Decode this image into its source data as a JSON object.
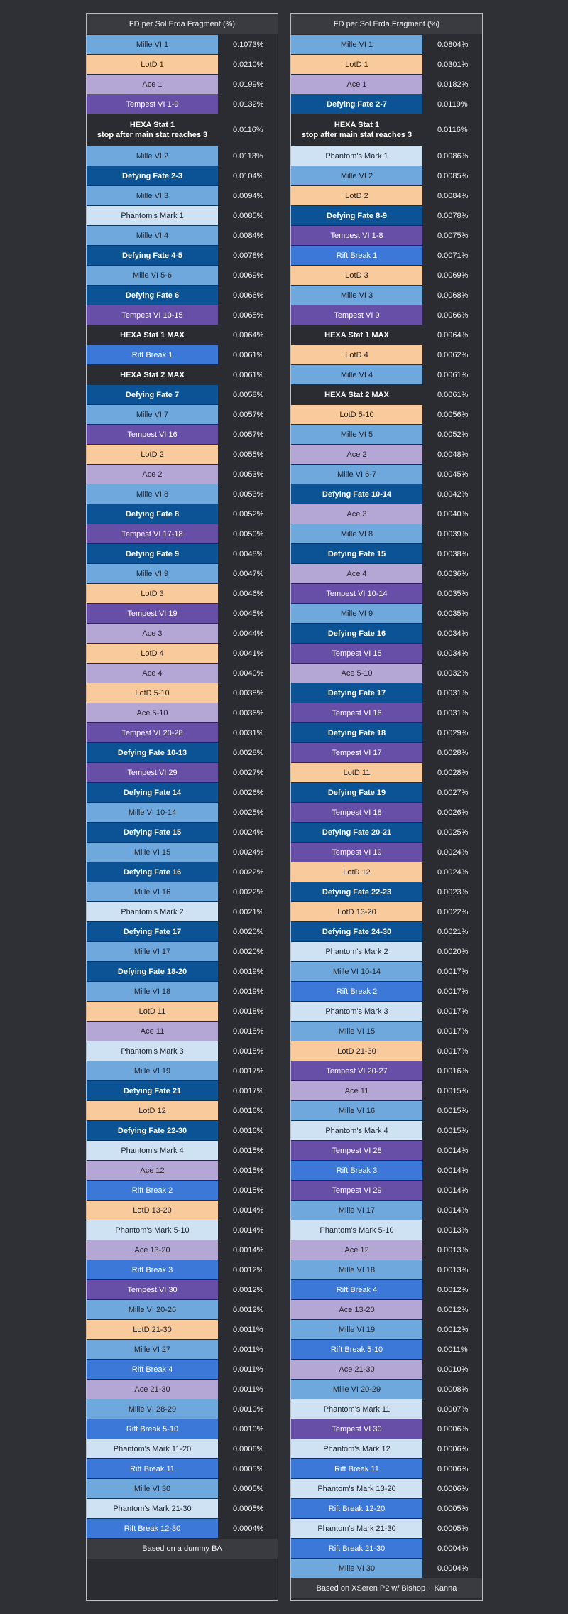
{
  "tables": [
    {
      "header": "FD per Sol Erda Fragment (%)",
      "footer": "Based on a dummy BA",
      "rows": [
        {
          "name": "Mille VI 1",
          "value": "0.1073%",
          "cat": "mille"
        },
        {
          "name": "LotD 1",
          "value": "0.0210%",
          "cat": "lotd"
        },
        {
          "name": "Ace 1",
          "value": "0.0199%",
          "cat": "ace"
        },
        {
          "name": "Tempest VI 1-9",
          "value": "0.0132%",
          "cat": "tempest"
        },
        {
          "name": "HEXA Stat 1\nstop after main stat reaches 3",
          "value": "0.0116%",
          "cat": "hexa",
          "tall": true
        },
        {
          "name": "Mille VI 2",
          "value": "0.0113%",
          "cat": "mille"
        },
        {
          "name": "Defying Fate 2-3",
          "value": "0.0104%",
          "cat": "defying"
        },
        {
          "name": "Mille VI 3",
          "value": "0.0094%",
          "cat": "mille"
        },
        {
          "name": "Phantom's Mark 1",
          "value": "0.0085%",
          "cat": "phantom"
        },
        {
          "name": "Mille VI 4",
          "value": "0.0084%",
          "cat": "mille"
        },
        {
          "name": "Defying Fate 4-5",
          "value": "0.0078%",
          "cat": "defying"
        },
        {
          "name": "Mille VI 5-6",
          "value": "0.0069%",
          "cat": "mille"
        },
        {
          "name": "Defying Fate 6",
          "value": "0.0066%",
          "cat": "defying"
        },
        {
          "name": "Tempest VI 10-15",
          "value": "0.0065%",
          "cat": "tempest"
        },
        {
          "name": "HEXA Stat 1 MAX",
          "value": "0.0064%",
          "cat": "hexa"
        },
        {
          "name": "Rift Break 1",
          "value": "0.0061%",
          "cat": "rift"
        },
        {
          "name": "HEXA Stat 2 MAX",
          "value": "0.0061%",
          "cat": "hexa"
        },
        {
          "name": "Defying Fate 7",
          "value": "0.0058%",
          "cat": "defying"
        },
        {
          "name": "Mille VI 7",
          "value": "0.0057%",
          "cat": "mille"
        },
        {
          "name": "Tempest VI 16",
          "value": "0.0057%",
          "cat": "tempest"
        },
        {
          "name": "LotD 2",
          "value": "0.0055%",
          "cat": "lotd"
        },
        {
          "name": "Ace 2",
          "value": "0.0053%",
          "cat": "ace"
        },
        {
          "name": "Mille VI 8",
          "value": "0.0053%",
          "cat": "mille"
        },
        {
          "name": "Defying Fate 8",
          "value": "0.0052%",
          "cat": "defying"
        },
        {
          "name": "Tempest VI 17-18",
          "value": "0.0050%",
          "cat": "tempest"
        },
        {
          "name": "Defying Fate 9",
          "value": "0.0048%",
          "cat": "defying"
        },
        {
          "name": "Mille VI 9",
          "value": "0.0047%",
          "cat": "mille"
        },
        {
          "name": "LotD 3",
          "value": "0.0046%",
          "cat": "lotd"
        },
        {
          "name": "Tempest VI 19",
          "value": "0.0045%",
          "cat": "tempest"
        },
        {
          "name": "Ace 3",
          "value": "0.0044%",
          "cat": "ace"
        },
        {
          "name": "LotD 4",
          "value": "0.0041%",
          "cat": "lotd"
        },
        {
          "name": "Ace 4",
          "value": "0.0040%",
          "cat": "ace"
        },
        {
          "name": "LotD 5-10",
          "value": "0.0038%",
          "cat": "lotd"
        },
        {
          "name": "Ace 5-10",
          "value": "0.0036%",
          "cat": "ace"
        },
        {
          "name": "Tempest VI 20-28",
          "value": "0.0031%",
          "cat": "tempest"
        },
        {
          "name": "Defying Fate 10-13",
          "value": "0.0028%",
          "cat": "defying"
        },
        {
          "name": "Tempest VI 29",
          "value": "0.0027%",
          "cat": "tempest"
        },
        {
          "name": "Defying Fate 14",
          "value": "0.0026%",
          "cat": "defying"
        },
        {
          "name": "Mille VI 10-14",
          "value": "0.0025%",
          "cat": "mille"
        },
        {
          "name": "Defying Fate 15",
          "value": "0.0024%",
          "cat": "defying"
        },
        {
          "name": "Mille VI 15",
          "value": "0.0024%",
          "cat": "mille"
        },
        {
          "name": "Defying Fate 16",
          "value": "0.0022%",
          "cat": "defying"
        },
        {
          "name": "Mille VI 16",
          "value": "0.0022%",
          "cat": "mille"
        },
        {
          "name": "Phantom's Mark 2",
          "value": "0.0021%",
          "cat": "phantom"
        },
        {
          "name": "Defying Fate 17",
          "value": "0.0020%",
          "cat": "defying"
        },
        {
          "name": "Mille VI 17",
          "value": "0.0020%",
          "cat": "mille"
        },
        {
          "name": "Defying Fate 18-20",
          "value": "0.0019%",
          "cat": "defying"
        },
        {
          "name": "Mille VI 18",
          "value": "0.0019%",
          "cat": "mille"
        },
        {
          "name": "LotD 11",
          "value": "0.0018%",
          "cat": "lotd"
        },
        {
          "name": "Ace 11",
          "value": "0.0018%",
          "cat": "ace"
        },
        {
          "name": "Phantom's Mark 3",
          "value": "0.0018%",
          "cat": "phantom"
        },
        {
          "name": "Mille VI 19",
          "value": "0.0017%",
          "cat": "mille"
        },
        {
          "name": "Defying Fate 21",
          "value": "0.0017%",
          "cat": "defying"
        },
        {
          "name": "LotD 12",
          "value": "0.0016%",
          "cat": "lotd"
        },
        {
          "name": "Defying Fate 22-30",
          "value": "0.0016%",
          "cat": "defying"
        },
        {
          "name": "Phantom's Mark 4",
          "value": "0.0015%",
          "cat": "phantom"
        },
        {
          "name": "Ace 12",
          "value": "0.0015%",
          "cat": "ace"
        },
        {
          "name": "Rift Break 2",
          "value": "0.0015%",
          "cat": "rift"
        },
        {
          "name": "LotD 13-20",
          "value": "0.0014%",
          "cat": "lotd"
        },
        {
          "name": "Phantom's Mark 5-10",
          "value": "0.0014%",
          "cat": "phantom"
        },
        {
          "name": "Ace 13-20",
          "value": "0.0014%",
          "cat": "ace"
        },
        {
          "name": "Rift Break 3",
          "value": "0.0012%",
          "cat": "rift"
        },
        {
          "name": "Tempest VI 30",
          "value": "0.0012%",
          "cat": "tempest"
        },
        {
          "name": "Mille VI 20-26",
          "value": "0.0012%",
          "cat": "mille"
        },
        {
          "name": "LotD 21-30",
          "value": "0.0011%",
          "cat": "lotd"
        },
        {
          "name": "Mille VI 27",
          "value": "0.0011%",
          "cat": "mille"
        },
        {
          "name": "Rift Break 4",
          "value": "0.0011%",
          "cat": "rift"
        },
        {
          "name": "Ace 21-30",
          "value": "0.0011%",
          "cat": "ace"
        },
        {
          "name": "Mille VI 28-29",
          "value": "0.0010%",
          "cat": "mille"
        },
        {
          "name": "Rift Break 5-10",
          "value": "0.0010%",
          "cat": "rift"
        },
        {
          "name": "Phantom's Mark 11-20",
          "value": "0.0006%",
          "cat": "phantom"
        },
        {
          "name": "Rift Break 11",
          "value": "0.0005%",
          "cat": "rift"
        },
        {
          "name": "Mille VI 30",
          "value": "0.0005%",
          "cat": "mille"
        },
        {
          "name": "Phantom's Mark 21-30",
          "value": "0.0005%",
          "cat": "phantom"
        },
        {
          "name": "Rift Break 12-30",
          "value": "0.0004%",
          "cat": "rift"
        }
      ]
    },
    {
      "header": "FD per Sol Erda Fragment (%)",
      "footer": "Based on XSeren P2 w/ Bishop + Kanna",
      "rows": [
        {
          "name": "Mille VI 1",
          "value": "0.0804%",
          "cat": "mille"
        },
        {
          "name": "LotD 1",
          "value": "0.0301%",
          "cat": "lotd"
        },
        {
          "name": "Ace 1",
          "value": "0.0182%",
          "cat": "ace"
        },
        {
          "name": "Defying Fate 2-7",
          "value": "0.0119%",
          "cat": "defying"
        },
        {
          "name": "HEXA Stat 1\nstop after main stat reaches 3",
          "value": "0.0116%",
          "cat": "hexa",
          "tall": true
        },
        {
          "name": "Phantom's Mark 1",
          "value": "0.0086%",
          "cat": "phantom"
        },
        {
          "name": "Mille VI 2",
          "value": "0.0085%",
          "cat": "mille"
        },
        {
          "name": "LotD 2",
          "value": "0.0084%",
          "cat": "lotd"
        },
        {
          "name": "Defying Fate 8-9",
          "value": "0.0078%",
          "cat": "defying"
        },
        {
          "name": "Tempest VI 1-8",
          "value": "0.0075%",
          "cat": "tempest"
        },
        {
          "name": "Rift Break 1",
          "value": "0.0071%",
          "cat": "rift"
        },
        {
          "name": "LotD 3",
          "value": "0.0069%",
          "cat": "lotd"
        },
        {
          "name": "Mille VI 3",
          "value": "0.0068%",
          "cat": "mille"
        },
        {
          "name": "Tempest VI 9",
          "value": "0.0066%",
          "cat": "tempest"
        },
        {
          "name": "HEXA Stat 1 MAX",
          "value": "0.0064%",
          "cat": "hexa"
        },
        {
          "name": "LotD 4",
          "value": "0.0062%",
          "cat": "lotd"
        },
        {
          "name": "Mille VI 4",
          "value": "0.0061%",
          "cat": "mille"
        },
        {
          "name": "HEXA Stat 2 MAX",
          "value": "0.0061%",
          "cat": "hexa"
        },
        {
          "name": "LotD 5-10",
          "value": "0.0056%",
          "cat": "lotd"
        },
        {
          "name": "Mille VI 5",
          "value": "0.0052%",
          "cat": "mille"
        },
        {
          "name": "Ace 2",
          "value": "0.0048%",
          "cat": "ace"
        },
        {
          "name": "Mille VI 6-7",
          "value": "0.0045%",
          "cat": "mille"
        },
        {
          "name": "Defying Fate 10-14",
          "value": "0.0042%",
          "cat": "defying"
        },
        {
          "name": "Ace 3",
          "value": "0.0040%",
          "cat": "ace"
        },
        {
          "name": "Mille VI 8",
          "value": "0.0039%",
          "cat": "mille"
        },
        {
          "name": "Defying Fate 15",
          "value": "0.0038%",
          "cat": "defying"
        },
        {
          "name": "Ace 4",
          "value": "0.0036%",
          "cat": "ace"
        },
        {
          "name": "Tempest VI 10-14",
          "value": "0.0035%",
          "cat": "tempest"
        },
        {
          "name": "Mille VI 9",
          "value": "0.0035%",
          "cat": "mille"
        },
        {
          "name": "Defying Fate 16",
          "value": "0.0034%",
          "cat": "defying"
        },
        {
          "name": "Tempest VI 15",
          "value": "0.0034%",
          "cat": "tempest"
        },
        {
          "name": "Ace 5-10",
          "value": "0.0032%",
          "cat": "ace"
        },
        {
          "name": "Defying Fate 17",
          "value": "0.0031%",
          "cat": "defying"
        },
        {
          "name": "Tempest VI 16",
          "value": "0.0031%",
          "cat": "tempest"
        },
        {
          "name": "Defying Fate 18",
          "value": "0.0029%",
          "cat": "defying"
        },
        {
          "name": "Tempest VI 17",
          "value": "0.0028%",
          "cat": "tempest"
        },
        {
          "name": "LotD 11",
          "value": "0.0028%",
          "cat": "lotd"
        },
        {
          "name": "Defying Fate 19",
          "value": "0.0027%",
          "cat": "defying"
        },
        {
          "name": "Tempest VI 18",
          "value": "0.0026%",
          "cat": "tempest"
        },
        {
          "name": "Defying Fate 20-21",
          "value": "0.0025%",
          "cat": "defying"
        },
        {
          "name": "Tempest VI 19",
          "value": "0.0024%",
          "cat": "tempest"
        },
        {
          "name": "LotD 12",
          "value": "0.0024%",
          "cat": "lotd"
        },
        {
          "name": "Defying Fate 22-23",
          "value": "0.0023%",
          "cat": "defying"
        },
        {
          "name": "LotD 13-20",
          "value": "0.0022%",
          "cat": "lotd"
        },
        {
          "name": "Defying Fate 24-30",
          "value": "0.0021%",
          "cat": "defying"
        },
        {
          "name": "Phantom's Mark 2",
          "value": "0.0020%",
          "cat": "phantom"
        },
        {
          "name": "Mille VI 10-14",
          "value": "0.0017%",
          "cat": "mille"
        },
        {
          "name": "Rift Break 2",
          "value": "0.0017%",
          "cat": "rift"
        },
        {
          "name": "Phantom's Mark 3",
          "value": "0.0017%",
          "cat": "phantom"
        },
        {
          "name": "Mille VI 15",
          "value": "0.0017%",
          "cat": "mille"
        },
        {
          "name": "LotD 21-30",
          "value": "0.0017%",
          "cat": "lotd"
        },
        {
          "name": "Tempest VI 20-27",
          "value": "0.0016%",
          "cat": "tempest"
        },
        {
          "name": "Ace 11",
          "value": "0.0015%",
          "cat": "ace"
        },
        {
          "name": "Mille VI 16",
          "value": "0.0015%",
          "cat": "mille"
        },
        {
          "name": "Phantom's Mark 4",
          "value": "0.0015%",
          "cat": "phantom"
        },
        {
          "name": "Tempest VI 28",
          "value": "0.0014%",
          "cat": "tempest"
        },
        {
          "name": "Rift Break 3",
          "value": "0.0014%",
          "cat": "rift"
        },
        {
          "name": "Tempest VI 29",
          "value": "0.0014%",
          "cat": "tempest"
        },
        {
          "name": "Mille VI 17",
          "value": "0.0014%",
          "cat": "mille"
        },
        {
          "name": "Phantom's Mark 5-10",
          "value": "0.0013%",
          "cat": "phantom"
        },
        {
          "name": "Ace 12",
          "value": "0.0013%",
          "cat": "ace"
        },
        {
          "name": "Mille VI 18",
          "value": "0.0013%",
          "cat": "mille"
        },
        {
          "name": "Rift Break 4",
          "value": "0.0012%",
          "cat": "rift"
        },
        {
          "name": "Ace 13-20",
          "value": "0.0012%",
          "cat": "ace"
        },
        {
          "name": "Mille VI 19",
          "value": "0.0012%",
          "cat": "mille"
        },
        {
          "name": "Rift Break 5-10",
          "value": "0.0011%",
          "cat": "rift"
        },
        {
          "name": "Ace 21-30",
          "value": "0.0010%",
          "cat": "ace"
        },
        {
          "name": "Mille VI 20-29",
          "value": "0.0008%",
          "cat": "mille"
        },
        {
          "name": "Phantom's Mark 11",
          "value": "0.0007%",
          "cat": "phantom"
        },
        {
          "name": "Tempest VI 30",
          "value": "0.0006%",
          "cat": "tempest"
        },
        {
          "name": "Phantom's Mark 12",
          "value": "0.0006%",
          "cat": "phantom"
        },
        {
          "name": "Rift Break 11",
          "value": "0.0006%",
          "cat": "rift"
        },
        {
          "name": "Phantom's Mark 13-20",
          "value": "0.0006%",
          "cat": "phantom"
        },
        {
          "name": "Rift Break 12-20",
          "value": "0.0005%",
          "cat": "rift"
        },
        {
          "name": "Phantom's Mark 21-30",
          "value": "0.0005%",
          "cat": "phantom"
        },
        {
          "name": "Rift Break 21-30",
          "value": "0.0004%",
          "cat": "rift"
        },
        {
          "name": "Mille VI 30",
          "value": "0.0004%",
          "cat": "mille"
        }
      ]
    }
  ],
  "category_colors": {
    "mille": "#6fa8dc",
    "lotd": "#f9cb9c",
    "ace": "#b4a7d6",
    "tempest": "#674ea7",
    "defying": "#0b5394",
    "phantom": "#cfe2f3",
    "rift": "#3c78d8",
    "hexa": "#2b2c31"
  }
}
